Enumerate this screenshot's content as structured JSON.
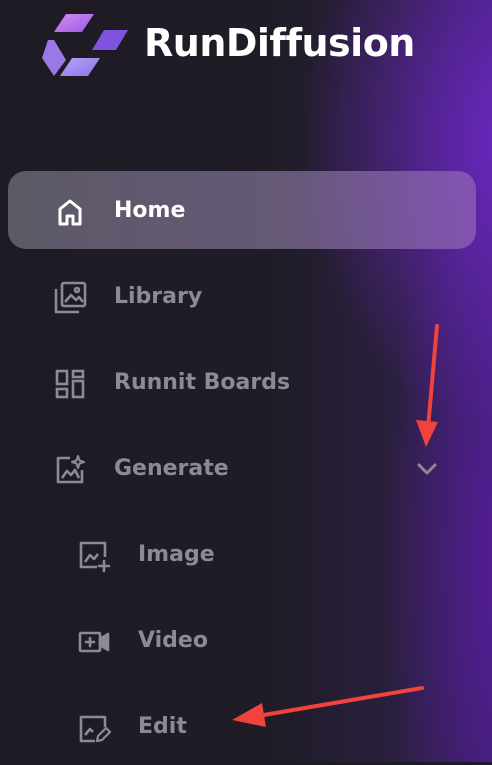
{
  "brand": {
    "name": "RunDiffusion"
  },
  "nav": {
    "items": [
      {
        "label": "Home",
        "icon": "home-icon",
        "active": true
      },
      {
        "label": "Library",
        "icon": "library-icon"
      },
      {
        "label": "Runnit Boards",
        "icon": "boards-grid-icon"
      },
      {
        "label": "Generate",
        "icon": "sparkle-image-icon",
        "expanded": true
      },
      {
        "label": "Image",
        "icon": "image-plus-icon",
        "sub": true
      },
      {
        "label": "Video",
        "icon": "video-camera-icon",
        "sub": true
      },
      {
        "label": "Edit",
        "icon": "image-edit-icon",
        "sub": true
      }
    ]
  },
  "annotations": {
    "arrow_color": "#f0433c"
  },
  "colors": {
    "active_text": "#ffffff",
    "inactive_text": "#8e8a95",
    "brand_purple": "#7b3ad9"
  }
}
